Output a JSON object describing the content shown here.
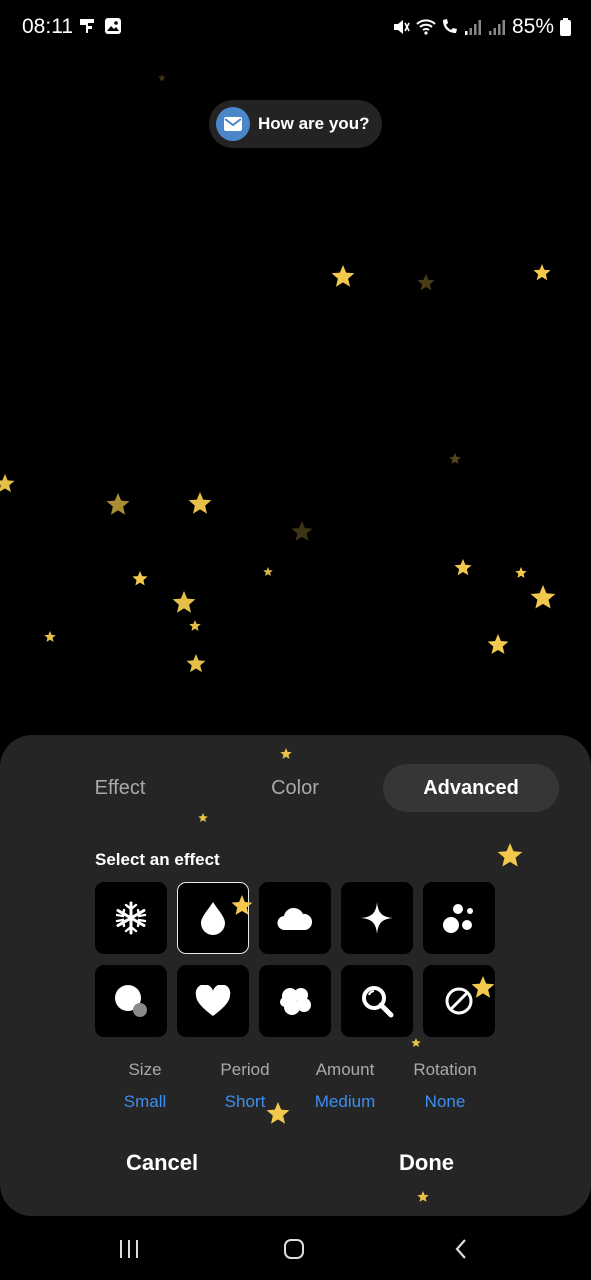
{
  "status_bar": {
    "time": "08:11",
    "battery": "85%",
    "left_icons": [
      "signal-tower-icon",
      "image-icon"
    ],
    "right_icons": [
      "mute-icon",
      "wifi-icon",
      "wifi-call-icon",
      "signal-icon",
      "signal-icon-2",
      "battery-icon"
    ]
  },
  "notification": {
    "text": "How are you?",
    "icon": "mail-icon"
  },
  "panel": {
    "tabs": [
      {
        "label": "Effect",
        "active": false
      },
      {
        "label": "Color",
        "active": false
      },
      {
        "label": "Advanced",
        "active": true
      }
    ],
    "section_label": "Select an effect",
    "effects": [
      {
        "name": "snowflake-icon",
        "selected": false
      },
      {
        "name": "water-drop-icon",
        "selected": true
      },
      {
        "name": "cloud-icon",
        "selected": false
      },
      {
        "name": "sparkle-icon",
        "selected": false
      },
      {
        "name": "bubbles-icon",
        "selected": false
      },
      {
        "name": "circle-dot-icon",
        "selected": false
      },
      {
        "name": "heart-icon",
        "selected": false
      },
      {
        "name": "blob-icon",
        "selected": false
      },
      {
        "name": "magnifier-icon",
        "selected": false
      },
      {
        "name": "none-icon",
        "selected": false
      }
    ],
    "options": [
      {
        "label": "Size",
        "value": "Small"
      },
      {
        "label": "Period",
        "value": "Short"
      },
      {
        "label": "Amount",
        "value": "Medium"
      },
      {
        "label": "Rotation",
        "value": "None"
      }
    ],
    "cancel_label": "Cancel",
    "done_label": "Done"
  },
  "colors": {
    "accent": "#3d8ef0",
    "star": "#f2c94c",
    "panel": "#252525"
  },
  "navbar": {
    "icons": [
      "recents-icon",
      "home-icon",
      "back-icon"
    ]
  }
}
